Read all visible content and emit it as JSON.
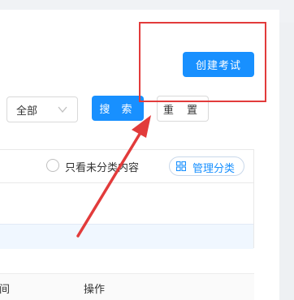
{
  "header": {
    "create_exam_label": "创建考试"
  },
  "filters": {
    "category_select_value": "全部",
    "search_label": "搜 索",
    "reset_label": "重 置"
  },
  "panel": {
    "unclassified_only_label": "只看未分类内容",
    "manage_category_label": "管理分类"
  },
  "table": {
    "columns": [
      "间",
      "操作"
    ]
  },
  "annotation": {
    "highlight_color": "#e23b3b"
  }
}
